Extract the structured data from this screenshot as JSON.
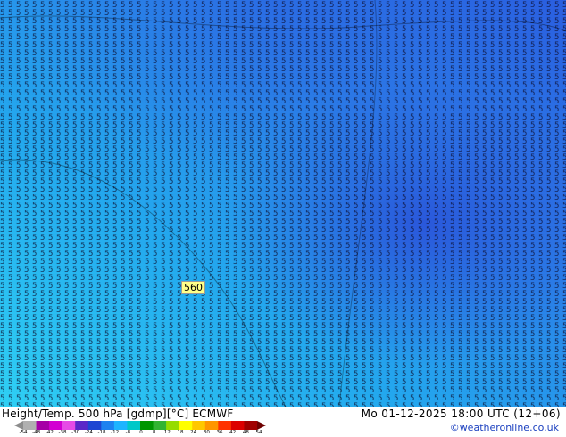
{
  "map": {
    "contour_label": "560",
    "field_glyph": "5",
    "colors": {
      "cyan": "#2fd0f4",
      "sky": "#23a8ee",
      "blue": "#2b74e6",
      "deep_blue": "#2a4fd8"
    }
  },
  "footer": {
    "title": "Height/Temp. 500 hPa [gdmp][°C] ECMWF",
    "datetime": "Mo 01-12-2025 18:00 UTC (12+06)",
    "credit": "©weatheronline.co.uk"
  },
  "colorbar": {
    "ticks": [
      "-54",
      "-48",
      "-42",
      "-38",
      "-30",
      "-24",
      "-18",
      "-12",
      "-8",
      "0",
      "8",
      "12",
      "18",
      "24",
      "30",
      "36",
      "42",
      "48",
      "54"
    ],
    "colors": [
      "#8c8c8c",
      "#b0b0b0",
      "#a600a6",
      "#d200d2",
      "#e64be6",
      "#5a28c8",
      "#1e46d2",
      "#1e82f0",
      "#1eb4ff",
      "#00c8c8",
      "#009600",
      "#32b432",
      "#96dc00",
      "#ffff00",
      "#ffc800",
      "#ff9600",
      "#ff3200",
      "#dc0000",
      "#a00000",
      "#6e0000"
    ]
  }
}
